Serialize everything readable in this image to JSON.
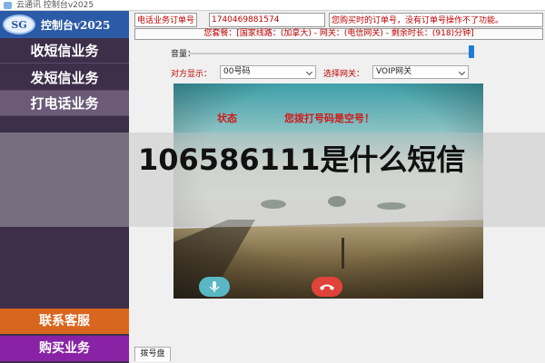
{
  "window": {
    "title": "云通讯 控制台v2025"
  },
  "logo": {
    "badge": "SG",
    "text": "控制台v2025"
  },
  "sidebar": {
    "items": [
      {
        "label": "收短信业务"
      },
      {
        "label": "发短信业务"
      },
      {
        "label": "打电话业务"
      }
    ],
    "contact_label": "联系客服",
    "buy_label": "购买业务"
  },
  "order": {
    "label": "电话业务订单号",
    "value": "1740469881574",
    "hint": "您购买时的订单号，没有订单号操作不了功能。"
  },
  "package": {
    "text": "您套餐：[国家线路：(加拿大) - 网关：(电信网关) - 剩余时长：(918)分钟]"
  },
  "volume": {
    "label": "音量：",
    "level_percent": 98
  },
  "caller_display": {
    "label": "对方显示：",
    "value": "00号码"
  },
  "gateway": {
    "label": "选择网关：",
    "value": "VOIP网关"
  },
  "call_status": {
    "label": "状态",
    "message": "您拨打号码是空号！"
  },
  "bottom_tab": {
    "label": "拨号盘"
  },
  "overlay": {
    "title": "106586111是什么短信"
  },
  "colors": {
    "sidebar_bg": "#3d2f4a",
    "contact_bg": "#d9661f",
    "buy_bg": "#8a22a6",
    "accent_red": "#c00000"
  },
  "icons": {
    "mute": "microphone-icon",
    "hangup": "phone-hangup-icon"
  }
}
